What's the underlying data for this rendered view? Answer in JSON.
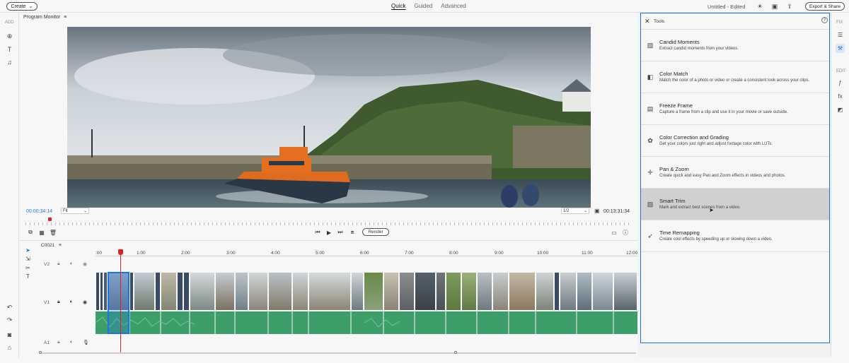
{
  "topbar": {
    "create_label": "Create",
    "modes": [
      "Quick",
      "Guided",
      "Advanced"
    ],
    "doc_title": "Untitled - Edited",
    "export_label": "Export & Share"
  },
  "leftrail": {
    "add_label": "ADD"
  },
  "monitor": {
    "title": "Program Monitor",
    "timecode_current": "00:00:34:14",
    "fit_value": "Fit",
    "quality_value": "1/2",
    "timecode_total": "00:13:31:34",
    "render_label": "Render"
  },
  "timeline": {
    "sequence_name": "C0021",
    "ruler": [
      ":00",
      "1:00",
      "2:00",
      "3:00",
      "4:00",
      "5:00",
      "6:00",
      "7:00",
      "8:00",
      "9:00",
      "10:00",
      "11:00",
      "12:00"
    ],
    "tracks": {
      "v2": "V2",
      "v1": "V1",
      "a1": "A1"
    }
  },
  "tools_panel": {
    "title": "Tools",
    "items": [
      {
        "name": "Candid Moments",
        "desc": "Extract candid moments from your videos."
      },
      {
        "name": "Color Match",
        "desc": "Match the color of a photo or video or create a consistent look across your clips."
      },
      {
        "name": "Freeze Frame",
        "desc": "Capture a frame from a clip and use it in your movie or save outside."
      },
      {
        "name": "Color Correction and Grading",
        "desc": "Get your colors just right and adjust footage color with LUTs."
      },
      {
        "name": "Pan & Zoom",
        "desc": "Create quick and easy Pan and Zoom effects in videos and photos."
      },
      {
        "name": "Smart Trim",
        "desc": "Mark and extract best scenes from a video."
      },
      {
        "name": "Time Remapping",
        "desc": "Create cool effects by speeding up or slowing down a video."
      }
    ]
  },
  "rightrail": {
    "fix_label": "FIX",
    "edit_label": "EDIT"
  },
  "colors": {
    "accent": "#1a73e8",
    "playhead": "#dd2222",
    "audio": "#3e9e6a"
  }
}
